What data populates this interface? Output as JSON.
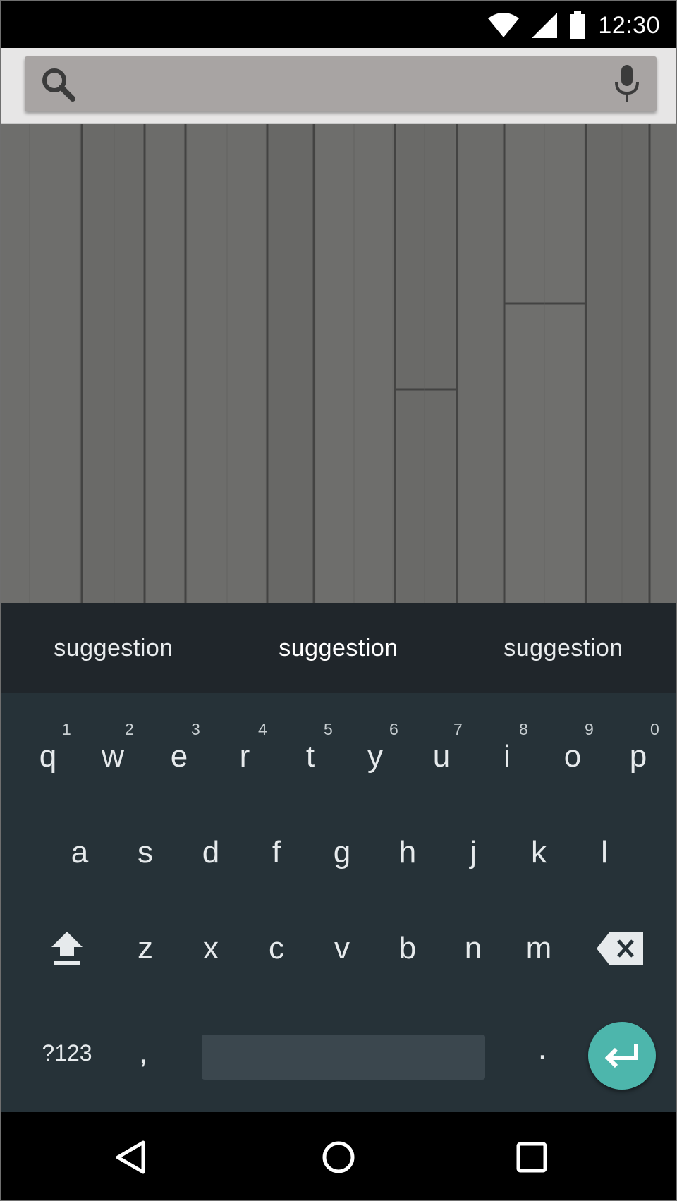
{
  "status_bar": {
    "time": "12:30",
    "icons": [
      "wifi-icon",
      "cell-signal-icon",
      "battery-icon"
    ]
  },
  "search": {
    "icons": [
      "search-icon",
      "mic-icon"
    ]
  },
  "suggestions": [
    "suggestion",
    "suggestion",
    "suggestion"
  ],
  "keyboard": {
    "row1": [
      {
        "key": "q",
        "hint": "1"
      },
      {
        "key": "w",
        "hint": "2"
      },
      {
        "key": "e",
        "hint": "3"
      },
      {
        "key": "r",
        "hint": "4"
      },
      {
        "key": "t",
        "hint": "5"
      },
      {
        "key": "y",
        "hint": "6"
      },
      {
        "key": "u",
        "hint": "7"
      },
      {
        "key": "i",
        "hint": "8"
      },
      {
        "key": "o",
        "hint": "9"
      },
      {
        "key": "p",
        "hint": "0"
      }
    ],
    "row2": [
      "a",
      "s",
      "d",
      "f",
      "g",
      "h",
      "j",
      "k",
      "l"
    ],
    "row3": [
      "z",
      "x",
      "c",
      "v",
      "b",
      "n",
      "m"
    ],
    "symbols_label": "?123",
    "comma": ",",
    "period": ".",
    "accent_color": "#4db6ac",
    "background_color": "#263238"
  },
  "nav": {
    "icons": [
      "back-icon",
      "home-icon",
      "recents-icon"
    ]
  }
}
